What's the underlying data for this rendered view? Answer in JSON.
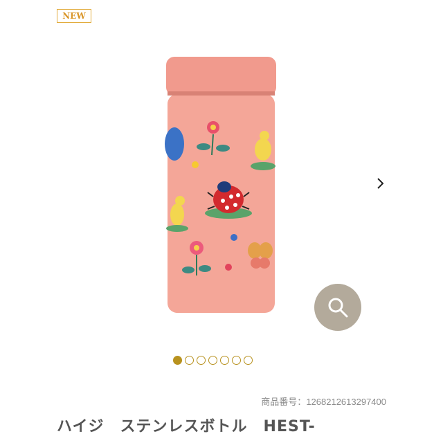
{
  "badge": {
    "new_label": "NEW"
  },
  "gallery": {
    "image_alt": "",
    "current_index": 1,
    "total_images": 7,
    "next_icon": "chevron-right-icon",
    "zoom_icon": "search-icon"
  },
  "product": {
    "code_label": "商品番号：",
    "code_value": "1268212613297400",
    "title": "ハイジ　ステンレスボトル　HEST-"
  },
  "colors": {
    "bottle_pink": "#f3a89c",
    "accent_gold": "#b8921f",
    "zoom_button": "#b3aa9b"
  }
}
